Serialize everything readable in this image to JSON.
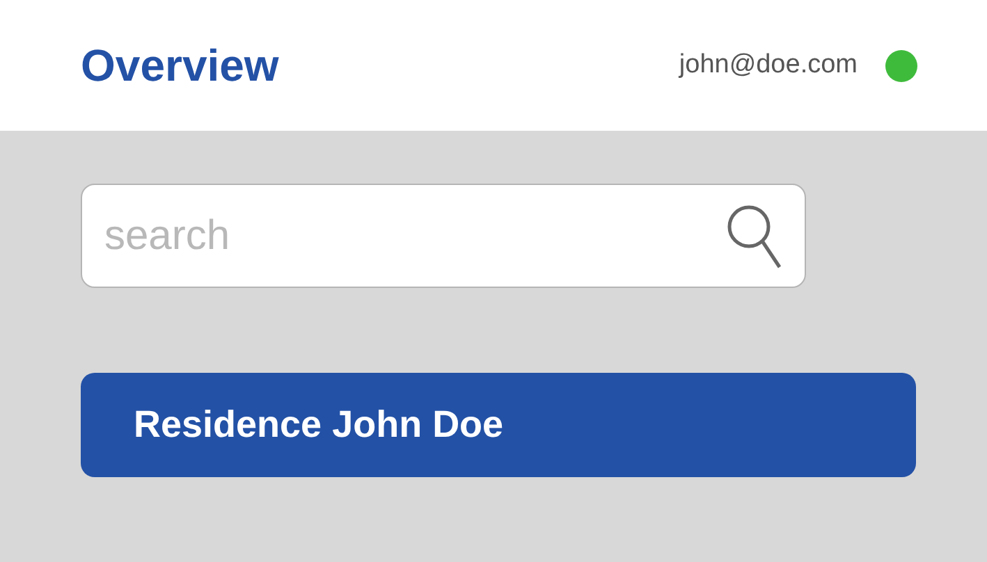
{
  "header": {
    "title": "Overview",
    "user": {
      "email": "john@doe.com",
      "online": true
    }
  },
  "search": {
    "placeholder": "search"
  },
  "items": [
    {
      "label": "Residence John Doe",
      "selected": true
    }
  ]
}
